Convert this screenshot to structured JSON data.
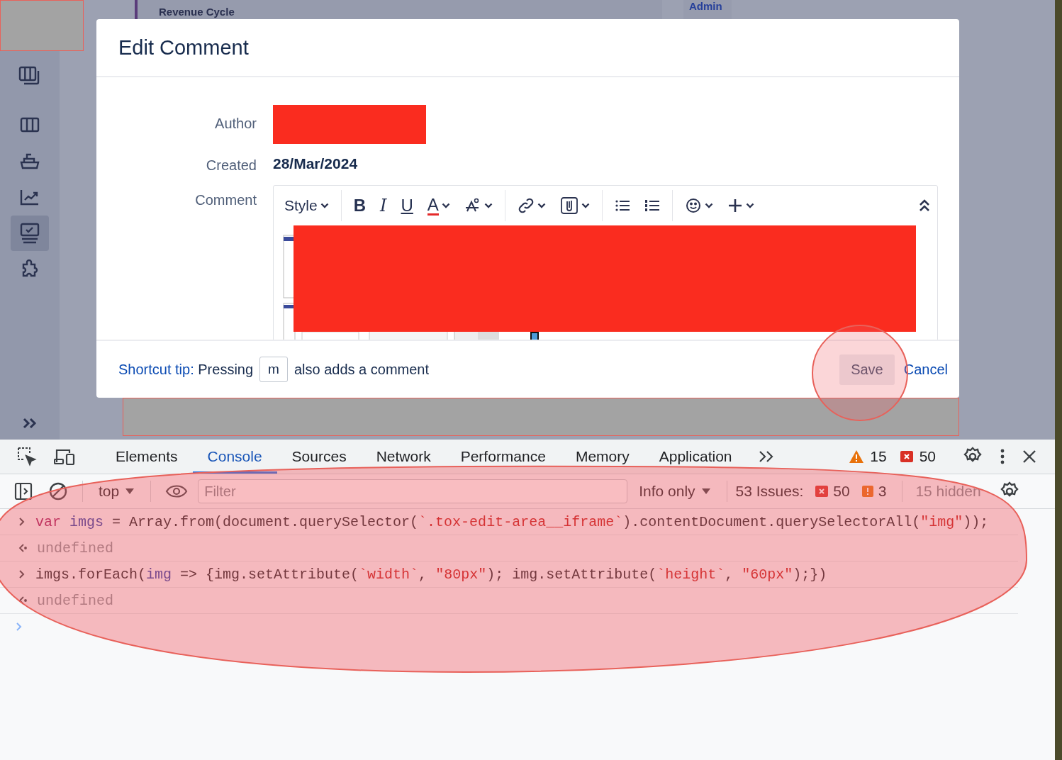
{
  "background": {
    "texts": [
      "Revenue Cycle",
      "Admin"
    ]
  },
  "sidebar": {
    "items": [
      {
        "kind": "columns-stack",
        "selected": false
      },
      {
        "kind": "columns",
        "selected": false
      },
      {
        "kind": "boat",
        "selected": false
      },
      {
        "kind": "chart",
        "selected": false
      },
      {
        "kind": "monitor",
        "selected": true
      },
      {
        "kind": "puzzle",
        "selected": false
      }
    ]
  },
  "dialog": {
    "title": "Edit Comment",
    "fields": [
      {
        "label": "Author",
        "kind": "redacted"
      },
      {
        "label": "Created",
        "kind": "text",
        "value": "28/Mar/2024"
      },
      {
        "label": "Comment",
        "kind": "editor"
      }
    ],
    "toolbar": {
      "groups": [
        [
          {
            "kind": "style",
            "label": "Style"
          }
        ],
        [
          {
            "kind": "bold",
            "glyph": "B"
          },
          {
            "kind": "italic",
            "glyph": "I"
          },
          {
            "kind": "underline",
            "glyph": "U"
          },
          {
            "kind": "color",
            "glyph": "A"
          },
          {
            "kind": "format"
          }
        ],
        [
          {
            "kind": "link"
          },
          {
            "kind": "attach"
          }
        ],
        [
          {
            "kind": "bullets"
          },
          {
            "kind": "numbers"
          }
        ],
        [
          {
            "kind": "emoji"
          },
          {
            "kind": "plus"
          }
        ]
      ]
    },
    "footer": {
      "tip_label": "Shortcut tip:",
      "tip_before": "Pressing",
      "key": "m",
      "tip_after": "also adds a comment",
      "save": "Save",
      "cancel": "Cancel"
    }
  },
  "devtools": {
    "tabs": [
      {
        "label": "Elements",
        "selected": false
      },
      {
        "label": "Console",
        "selected": true
      },
      {
        "label": "Sources",
        "selected": false
      },
      {
        "label": "Network",
        "selected": false
      },
      {
        "label": "Performance",
        "selected": false
      },
      {
        "label": "Memory",
        "selected": false
      },
      {
        "label": "Application",
        "selected": false
      }
    ],
    "warnings": "15",
    "errors": "50",
    "context": "top",
    "filter_placeholder": "Filter",
    "level": "Info only",
    "issues_label": "53 Issues:",
    "issues_errors": "50",
    "issues_warnings": "3",
    "hidden": "15 hidden",
    "lines": [
      {
        "kind": "input",
        "segments": [
          {
            "t": "var",
            "kind": "keyword"
          },
          {
            "t": " imgs",
            "kind": "variable"
          },
          {
            "t": " = Array.from(document.querySelector(",
            "kind": "plain"
          },
          {
            "t": "`.tox-edit-area__iframe`",
            "kind": "string"
          },
          {
            "t": ").contentDocument.querySelectorAll(",
            "kind": "plain"
          },
          {
            "t": "\"img\"",
            "kind": "string"
          },
          {
            "t": "));",
            "kind": "plain"
          }
        ]
      },
      {
        "kind": "output",
        "segments": [
          {
            "t": "undefined",
            "kind": "plain"
          }
        ]
      },
      {
        "kind": "input",
        "segments": [
          {
            "t": "imgs.forEach(",
            "kind": "plain"
          },
          {
            "t": "img",
            "kind": "variable"
          },
          {
            "t": " => {img.setAttribute(",
            "kind": "plain"
          },
          {
            "t": "`width`",
            "kind": "string"
          },
          {
            "t": ", ",
            "kind": "plain"
          },
          {
            "t": "\"80px\"",
            "kind": "string"
          },
          {
            "t": "); img.setAttribute(",
            "kind": "plain"
          },
          {
            "t": "`height`",
            "kind": "string"
          },
          {
            "t": ", ",
            "kind": "plain"
          },
          {
            "t": "\"60px\"",
            "kind": "string"
          },
          {
            "t": ");})",
            "kind": "plain"
          }
        ]
      },
      {
        "kind": "output",
        "segments": [
          {
            "t": "undefined",
            "kind": "plain"
          }
        ]
      }
    ]
  }
}
